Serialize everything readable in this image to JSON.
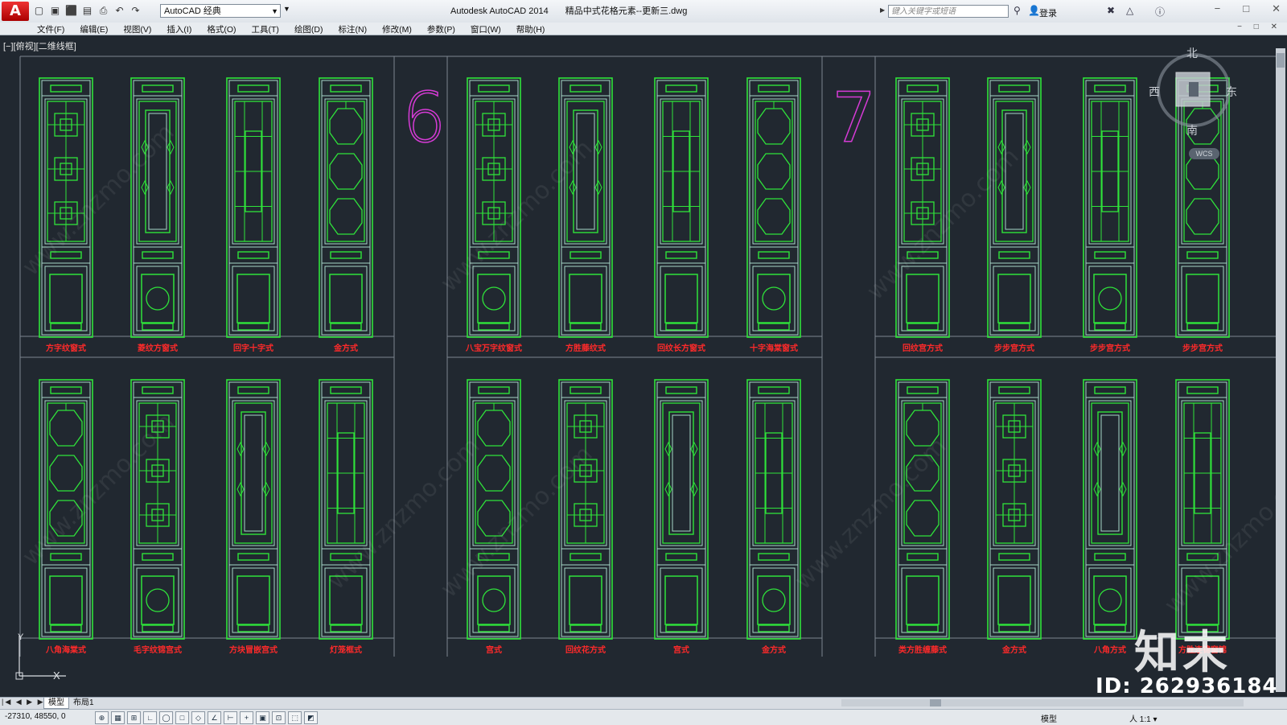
{
  "titlebar": {
    "logo": "A",
    "quick_access": [
      "▢",
      "▣",
      "⬛",
      "▤",
      "⎙",
      "↶",
      "↷"
    ],
    "workspace": "AutoCAD 经典",
    "app_name": "Autodesk AutoCAD 2014",
    "file_name": "精品中式花格元素--更新三.dwg",
    "search_placeholder": "键入关键字或短语",
    "login": "登录",
    "window_controls": [
      "−",
      "□",
      "✕"
    ]
  },
  "menubar": {
    "items": [
      "文件(F)",
      "编辑(E)",
      "视图(V)",
      "插入(I)",
      "格式(O)",
      "工具(T)",
      "绘图(D)",
      "标注(N)",
      "修改(M)",
      "参数(P)",
      "窗口(W)",
      "帮助(H)"
    ],
    "mdi_controls": "− □ ✕"
  },
  "viewport": {
    "label": "[−][俯视][二维线框]",
    "section_numbers": [
      "6",
      "7"
    ],
    "nav": {
      "north": "北",
      "south": "南",
      "west": "西",
      "east": "东",
      "wcs": "WCS"
    },
    "ucs": {
      "y": "Y",
      "x": "X"
    },
    "colors": {
      "frame": "#2fe33a",
      "frame_outline": "#a8d8c8",
      "label": "#ff2a2a",
      "section": "#d63bd6",
      "background": "#212830"
    },
    "panel_labels": {
      "row1": [
        "方字纹窗式",
        "菱纹方窗式",
        "回字十字式",
        "金方式",
        "八宝万字纹窗式",
        "方胜藤纹式",
        "回纹长方窗式",
        "十字海棠窗式",
        "回纹宫方式",
        "步步宫方式",
        "步步宫方式",
        "步步宫方式"
      ],
      "row2": [
        "八角海棠式",
        "毛字纹锦宫式",
        "方块冒嵌宫式",
        "灯笼框式",
        "宫式",
        "回纹花方式",
        "宫式",
        "金方式",
        "类方胜缠藤式",
        "金方式",
        "八角方式",
        "方胜连锦窗锦"
      ]
    }
  },
  "tabs": {
    "model": "模型",
    "layout": "布局1",
    "arrows": "|◀ ◀ ▶ ▶|"
  },
  "statusbar": {
    "coords": "-27310, 48550, 0",
    "toggles": [
      "⊕",
      "▦",
      "⊞",
      "∟",
      "◯",
      "□",
      "◇",
      "∠",
      "⊢",
      "+",
      "▣",
      "⊡",
      "⬚",
      "◩"
    ],
    "model_space": "模型",
    "scale": "人 1:1 ▾"
  },
  "watermark": {
    "brand": "知末",
    "id": "ID: 262936184",
    "site": "www.znzmo.com"
  }
}
